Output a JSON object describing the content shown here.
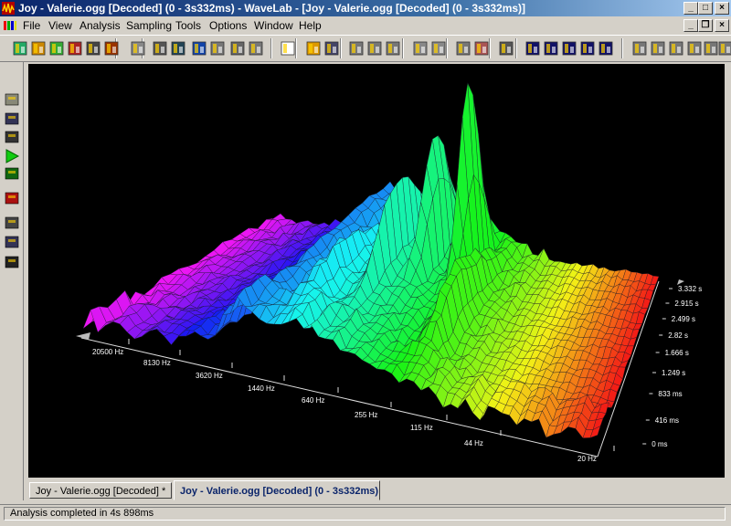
{
  "window": {
    "title": "Joy - Valerie.ogg [Decoded] (0 - 3s332ms) - WaveLab - [Joy - Valerie.ogg [Decoded] (0 - 3s332ms)]"
  },
  "menu": {
    "items": [
      "File",
      "View",
      "Analysis",
      "Sampling",
      "Tools",
      "Options",
      "Window",
      "Help"
    ]
  },
  "toolbar": {
    "icons": [
      "spectrum-view-icon",
      "level-meter-icon",
      "spectroscope-icon",
      "bit-meter-icon",
      "phase-meter-icon",
      "wave-meter-icon",
      "crop-icon",
      "speaker-icon",
      "zoom-icon",
      "pause-icon",
      "jump-icon",
      "stop-icon",
      "loop-icon",
      "new-file-icon",
      "open-folder-icon",
      "save-icon",
      "cut-icon",
      "copy-icon",
      "paste-icon",
      "undo-icon",
      "redo-icon",
      "mix-icon",
      "eraser-icon",
      "speaker-small-icon",
      "tile-icon",
      "split-icon",
      "horizontal-icon",
      "cascade-icon",
      "window-list-icon",
      "cursor-move-icon",
      "navigate-back-icon",
      "navigate-forward-icon",
      "crossfade-icon",
      "forward-icon",
      "settings-icon"
    ]
  },
  "lefttoolbar": {
    "icons": [
      "tape-icon",
      "globe-icon",
      "camera-icon",
      "play-icon",
      "marker-list-icon",
      "filter-icon",
      "battery-icon",
      "stopwatch-icon",
      "microphone-icon"
    ]
  },
  "plot": {
    "freq_labels": [
      "20500 Hz",
      "8130 Hz",
      "3620 Hz",
      "1440 Hz",
      "640 Hz",
      "255 Hz",
      "115 Hz",
      "44 Hz",
      "20 Hz"
    ],
    "time_labels": [
      "3.332 s",
      "2.915 s",
      "2.499 s",
      "2.82 s",
      "1.666 s",
      "1.249 s",
      "833 ms",
      "416 ms",
      "0 ms"
    ]
  },
  "chart_data": {
    "type": "3d-surface",
    "title": "",
    "x_axis": {
      "label": "",
      "ticks": [
        "20500 Hz",
        "8130 Hz",
        "3620 Hz",
        "1440 Hz",
        "640 Hz",
        "255 Hz",
        "115 Hz",
        "44 Hz",
        "20 Hz"
      ]
    },
    "y_axis": {
      "label": "",
      "ticks": [
        "0 ms",
        "416 ms",
        "833 ms",
        "1.249 s",
        "1.666 s",
        "2.82 s",
        "2.499 s",
        "2.915 s",
        "3.332 s"
      ]
    },
    "background": "#000000"
  },
  "tabs": [
    {
      "label": "Joy - Valerie.ogg [Decoded] *",
      "active": false
    },
    {
      "label": "Joy - Valerie.ogg [Decoded] (0 - 3s332ms)",
      "active": true
    }
  ],
  "status": {
    "text": "Analysis completed in 4s 898ms"
  }
}
